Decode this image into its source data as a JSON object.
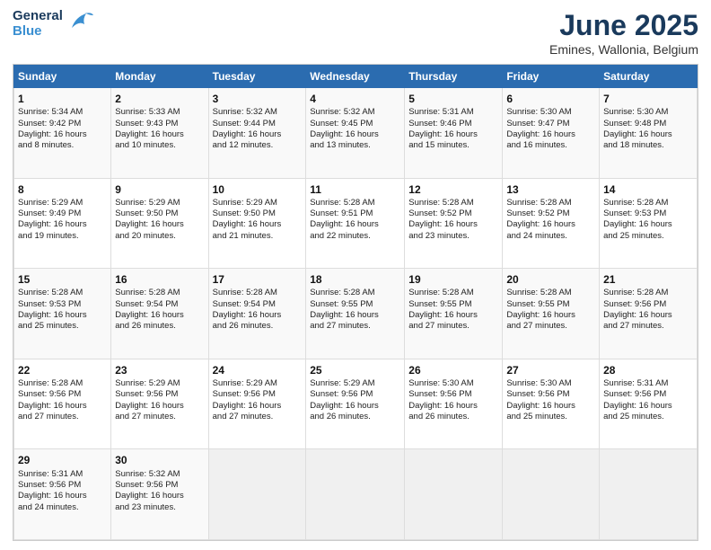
{
  "header": {
    "logo_line1": "General",
    "logo_line2": "Blue",
    "title": "June 2025",
    "subtitle": "Emines, Wallonia, Belgium"
  },
  "days_of_week": [
    "Sunday",
    "Monday",
    "Tuesday",
    "Wednesday",
    "Thursday",
    "Friday",
    "Saturday"
  ],
  "weeks": [
    [
      {
        "day": "1",
        "info": "Sunrise: 5:34 AM\nSunset: 9:42 PM\nDaylight: 16 hours\nand 8 minutes."
      },
      {
        "day": "2",
        "info": "Sunrise: 5:33 AM\nSunset: 9:43 PM\nDaylight: 16 hours\nand 10 minutes."
      },
      {
        "day": "3",
        "info": "Sunrise: 5:32 AM\nSunset: 9:44 PM\nDaylight: 16 hours\nand 12 minutes."
      },
      {
        "day": "4",
        "info": "Sunrise: 5:32 AM\nSunset: 9:45 PM\nDaylight: 16 hours\nand 13 minutes."
      },
      {
        "day": "5",
        "info": "Sunrise: 5:31 AM\nSunset: 9:46 PM\nDaylight: 16 hours\nand 15 minutes."
      },
      {
        "day": "6",
        "info": "Sunrise: 5:30 AM\nSunset: 9:47 PM\nDaylight: 16 hours\nand 16 minutes."
      },
      {
        "day": "7",
        "info": "Sunrise: 5:30 AM\nSunset: 9:48 PM\nDaylight: 16 hours\nand 18 minutes."
      }
    ],
    [
      {
        "day": "8",
        "info": "Sunrise: 5:29 AM\nSunset: 9:49 PM\nDaylight: 16 hours\nand 19 minutes."
      },
      {
        "day": "9",
        "info": "Sunrise: 5:29 AM\nSunset: 9:50 PM\nDaylight: 16 hours\nand 20 minutes."
      },
      {
        "day": "10",
        "info": "Sunrise: 5:29 AM\nSunset: 9:50 PM\nDaylight: 16 hours\nand 21 minutes."
      },
      {
        "day": "11",
        "info": "Sunrise: 5:28 AM\nSunset: 9:51 PM\nDaylight: 16 hours\nand 22 minutes."
      },
      {
        "day": "12",
        "info": "Sunrise: 5:28 AM\nSunset: 9:52 PM\nDaylight: 16 hours\nand 23 minutes."
      },
      {
        "day": "13",
        "info": "Sunrise: 5:28 AM\nSunset: 9:52 PM\nDaylight: 16 hours\nand 24 minutes."
      },
      {
        "day": "14",
        "info": "Sunrise: 5:28 AM\nSunset: 9:53 PM\nDaylight: 16 hours\nand 25 minutes."
      }
    ],
    [
      {
        "day": "15",
        "info": "Sunrise: 5:28 AM\nSunset: 9:53 PM\nDaylight: 16 hours\nand 25 minutes."
      },
      {
        "day": "16",
        "info": "Sunrise: 5:28 AM\nSunset: 9:54 PM\nDaylight: 16 hours\nand 26 minutes."
      },
      {
        "day": "17",
        "info": "Sunrise: 5:28 AM\nSunset: 9:54 PM\nDaylight: 16 hours\nand 26 minutes."
      },
      {
        "day": "18",
        "info": "Sunrise: 5:28 AM\nSunset: 9:55 PM\nDaylight: 16 hours\nand 27 minutes."
      },
      {
        "day": "19",
        "info": "Sunrise: 5:28 AM\nSunset: 9:55 PM\nDaylight: 16 hours\nand 27 minutes."
      },
      {
        "day": "20",
        "info": "Sunrise: 5:28 AM\nSunset: 9:55 PM\nDaylight: 16 hours\nand 27 minutes."
      },
      {
        "day": "21",
        "info": "Sunrise: 5:28 AM\nSunset: 9:56 PM\nDaylight: 16 hours\nand 27 minutes."
      }
    ],
    [
      {
        "day": "22",
        "info": "Sunrise: 5:28 AM\nSunset: 9:56 PM\nDaylight: 16 hours\nand 27 minutes."
      },
      {
        "day": "23",
        "info": "Sunrise: 5:29 AM\nSunset: 9:56 PM\nDaylight: 16 hours\nand 27 minutes."
      },
      {
        "day": "24",
        "info": "Sunrise: 5:29 AM\nSunset: 9:56 PM\nDaylight: 16 hours\nand 27 minutes."
      },
      {
        "day": "25",
        "info": "Sunrise: 5:29 AM\nSunset: 9:56 PM\nDaylight: 16 hours\nand 26 minutes."
      },
      {
        "day": "26",
        "info": "Sunrise: 5:30 AM\nSunset: 9:56 PM\nDaylight: 16 hours\nand 26 minutes."
      },
      {
        "day": "27",
        "info": "Sunrise: 5:30 AM\nSunset: 9:56 PM\nDaylight: 16 hours\nand 25 minutes."
      },
      {
        "day": "28",
        "info": "Sunrise: 5:31 AM\nSunset: 9:56 PM\nDaylight: 16 hours\nand 25 minutes."
      }
    ],
    [
      {
        "day": "29",
        "info": "Sunrise: 5:31 AM\nSunset: 9:56 PM\nDaylight: 16 hours\nand 24 minutes."
      },
      {
        "day": "30",
        "info": "Sunrise: 5:32 AM\nSunset: 9:56 PM\nDaylight: 16 hours\nand 23 minutes."
      },
      {
        "day": "",
        "info": ""
      },
      {
        "day": "",
        "info": ""
      },
      {
        "day": "",
        "info": ""
      },
      {
        "day": "",
        "info": ""
      },
      {
        "day": "",
        "info": ""
      }
    ]
  ]
}
